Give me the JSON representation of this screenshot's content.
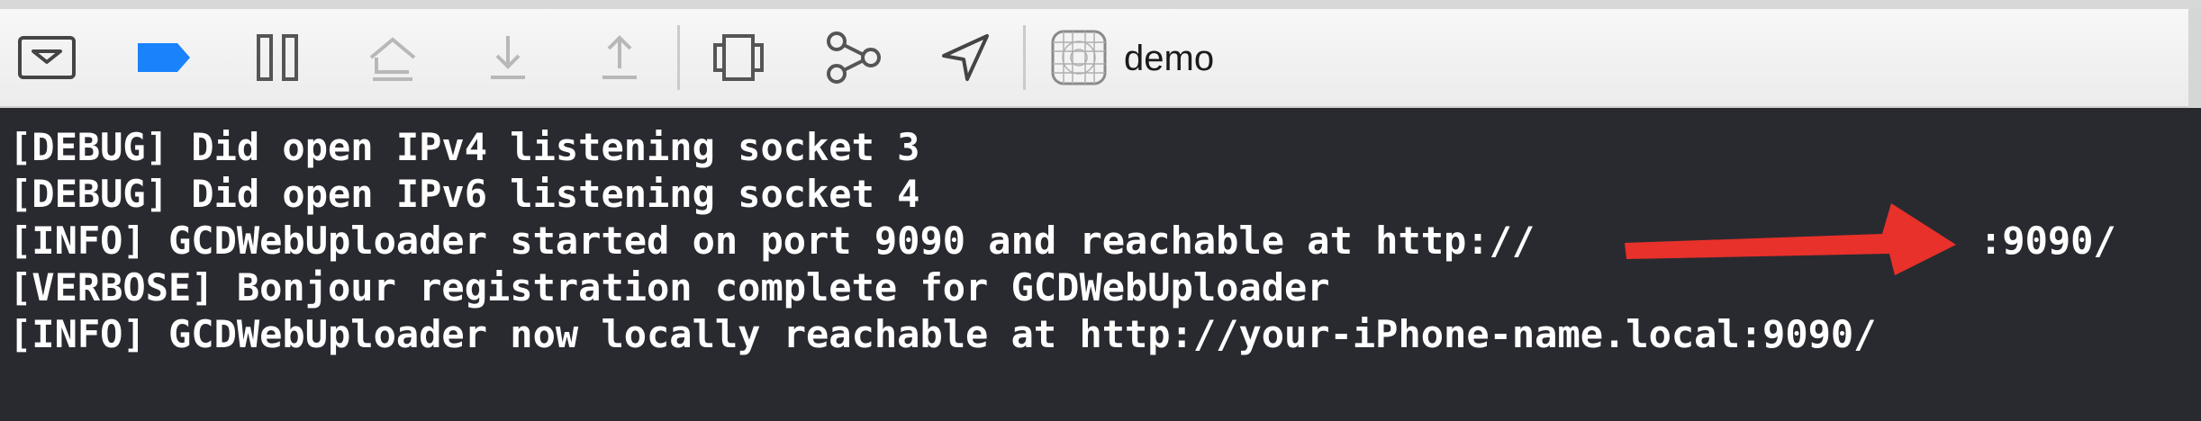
{
  "toolbar": {
    "buttons": [
      {
        "name": "hide-debug-area",
        "icon": "panel-down-icon"
      },
      {
        "name": "breakpoints-toggle",
        "icon": "breakpoint-icon",
        "color": "#1a82fb"
      },
      {
        "name": "pause",
        "icon": "pause-icon"
      },
      {
        "name": "step-over",
        "icon": "step-over-icon"
      },
      {
        "name": "step-into",
        "icon": "step-into-icon"
      },
      {
        "name": "step-out",
        "icon": "step-out-icon"
      },
      {
        "name": "view-hierarchy",
        "icon": "view-hierarchy-icon"
      },
      {
        "name": "memory-graph",
        "icon": "memory-graph-icon"
      },
      {
        "name": "simulate-location",
        "icon": "location-arrow-icon"
      }
    ],
    "scheme": {
      "icon": "app-icon",
      "label": "demo"
    }
  },
  "console": {
    "lines": [
      "[DEBUG] Did open IPv4 listening socket 3",
      "[DEBUG] Did open IPv6 listening socket 4",
      "[INFO] GCDWebUploader started on port 9090 and reachable at http://",
      ":9090/",
      "[VERBOSE] Bonjour registration complete for GCDWebUploader",
      "[INFO] GCDWebUploader now locally reachable at http://your-iPhone-name.local:9090/"
    ]
  },
  "annotation": {
    "icon": "red-arrow-icon",
    "color": "#e8312a"
  }
}
